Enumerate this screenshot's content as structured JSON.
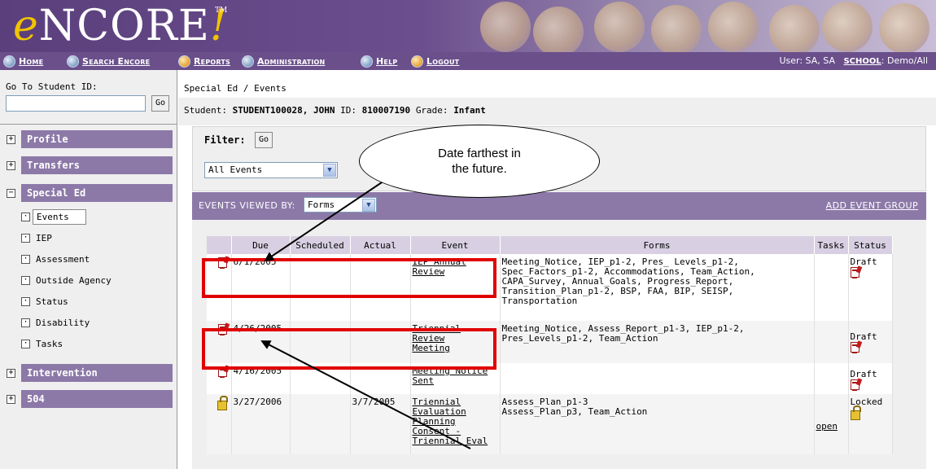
{
  "app": {
    "logo_text": "NCORE",
    "logo_e": "e",
    "logo_bang": "!",
    "logo_tm": "TM"
  },
  "nav": {
    "items": [
      {
        "label": "Home",
        "icon": "house-icon"
      },
      {
        "label": "Search Encore",
        "icon": "magnifier-icon"
      },
      {
        "label": "Reports",
        "icon": "report-icon"
      },
      {
        "label": "Administration",
        "icon": "admin-icon"
      },
      {
        "label": "Help",
        "icon": "help-icon"
      },
      {
        "label": "Logout",
        "icon": "logout-icon"
      }
    ],
    "user_text": "User: SA, SA",
    "school_label": "SCHOOL",
    "school_value": ": Demo/All"
  },
  "sidebar": {
    "goto_label": "Go To Student ID:",
    "goto_value": "",
    "go_label": "Go",
    "sections": [
      {
        "label": "Profile",
        "expander": "+"
      },
      {
        "label": "Transfers",
        "expander": "+"
      },
      {
        "label": "Special Ed",
        "expander": "−"
      },
      {
        "label": "Intervention",
        "expander": "+"
      },
      {
        "label": "504",
        "expander": "+"
      }
    ],
    "special_ed_items": [
      "Events",
      "IEP",
      "Assessment",
      "Outside Agency",
      "Status",
      "Disability",
      "Tasks"
    ],
    "sub_expander": "·"
  },
  "main": {
    "breadcrumb": "Special Ed / Events",
    "student_prefix": "Student:",
    "student_name": "STUDENT100028, JOHN",
    "id_prefix": "ID:",
    "id_value": "810007190",
    "grade_prefix": "Grade:",
    "grade_value": "Infant",
    "filter_label": "Filter:",
    "filter_go": "Go",
    "events_select": "All Events",
    "viewed_by_label": "EVENTS VIEWED BY:",
    "viewed_by_value": "Forms",
    "add_event_group": "ADD EVENT GROUP"
  },
  "table": {
    "headers": [
      "",
      "Due",
      "Scheduled",
      "Actual",
      "Event",
      "Forms",
      "Tasks",
      "Status"
    ],
    "rows": [
      {
        "icon": "document-icon",
        "due": "6/1/2005",
        "scheduled": "",
        "actual": "",
        "event_lines": [
          "IEP Annual",
          "Review"
        ],
        "forms_lines": [
          "Meeting_Notice, IEP_p1-2, Pres_ Levels_p1-2,",
          "Spec_Factors_p1-2, Accommodations, Team_Action,",
          "CAPA_Survey, Annual_Goals, Progress_Report,",
          "Transition_Plan_p1-2, BSP, FAA, BIP, SEISP,",
          "Transportation"
        ],
        "tasks": "",
        "status": "Draft",
        "status_icon": "document-icon"
      },
      {
        "icon": "document-icon",
        "due": "4/26/2005",
        "scheduled": "",
        "actual": "",
        "event_lines": [
          "Triennial",
          "Review",
          "Meeting"
        ],
        "forms_lines": [
          "Meeting_Notice, Assess_Report_p1-3, IEP_p1-2,",
          "Pres_Levels_p1-2, Team_Action"
        ],
        "tasks": "",
        "status": "Draft",
        "status_icon": "document-icon"
      },
      {
        "icon": "document-icon",
        "due": "4/16/2005",
        "scheduled": "",
        "actual": "",
        "event_lines": [
          "Meeting Notice",
          "Sent"
        ],
        "forms_lines": [],
        "tasks": "",
        "status": "Draft",
        "status_icon": "document-icon"
      },
      {
        "icon": "lock-icon",
        "due": "3/27/2006",
        "scheduled": "",
        "actual": "3/7/2005",
        "event_lines": [
          "Triennial",
          "Evaluation",
          "Planning",
          "Consent -",
          "Triennial Eval"
        ],
        "forms_lines": [
          "Assess_Plan_p1-3",
          "Assess_Plan_p3, Team_Action"
        ],
        "tasks": "open",
        "status": "Locked",
        "status_icon": "lock-icon"
      }
    ]
  },
  "annotation": {
    "callout_lines": [
      "Date farthest in",
      "the future."
    ],
    "highlight_color": "#e00000"
  }
}
